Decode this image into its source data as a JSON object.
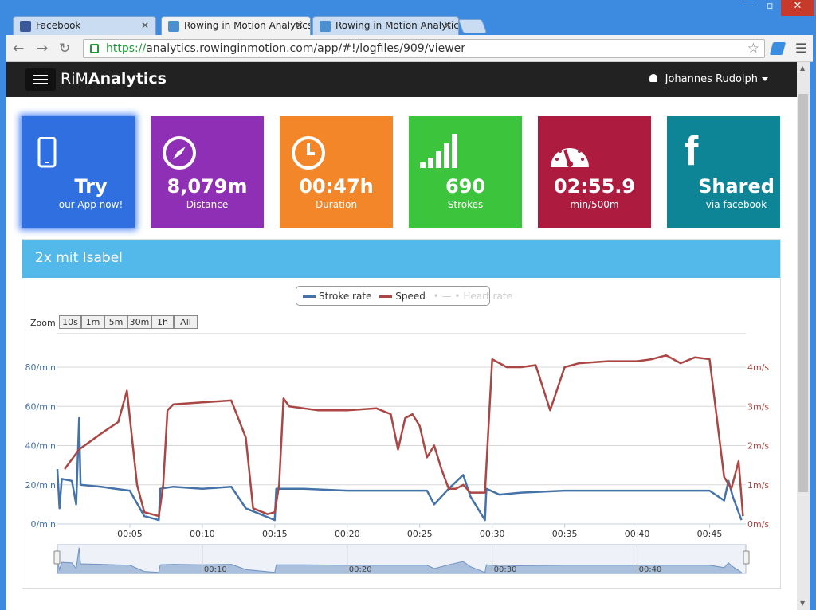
{
  "browser": {
    "tabs": [
      {
        "title": "Facebook",
        "favicon_color": "#3b5998"
      },
      {
        "title": "Rowing in Motion Analytics",
        "favicon_color": "#4a90d0"
      },
      {
        "title": "Rowing in Motion Analytics",
        "favicon_color": "#4a90d0"
      }
    ],
    "url_scheme": "https://",
    "url_rest": "analytics.rowinginmotion.com/app/#!/logfiles/909/viewer"
  },
  "navbar": {
    "brand_light": "RiM",
    "brand_bold": "Analytics",
    "user_name": "Johannes Rudolph"
  },
  "tiles": [
    {
      "value": "Try",
      "label": "our App now!",
      "color": "#2f6fe0",
      "icon": "phone-icon"
    },
    {
      "value": "8,079m",
      "label": "Distance",
      "color": "#8e2fb5",
      "icon": "compass-icon"
    },
    {
      "value": "00:47h",
      "label": "Duration",
      "color": "#f4862a",
      "icon": "clock-icon"
    },
    {
      "value": "690",
      "label": "Strokes",
      "color": "#3dc43d",
      "icon": "signal-bars-icon"
    },
    {
      "value": "02:55.9",
      "label": "min/500m",
      "color": "#ad1c3e",
      "icon": "speedometer-icon"
    },
    {
      "value": "Shared",
      "label": "via facebook",
      "color": "#0d8597",
      "icon": "facebook-icon"
    }
  ],
  "panel": {
    "title": "2x mit Isabel"
  },
  "legend": {
    "stroke_rate": "Stroke rate",
    "speed": "Speed",
    "heart_rate": "Heart rate"
  },
  "zoom": {
    "label": "Zoom",
    "buttons": [
      "10s",
      "1m",
      "5m",
      "30m",
      "1h",
      "All"
    ]
  },
  "chart_data": {
    "type": "line",
    "x_unit": "mm:ss",
    "x_ticks": [
      "00:05",
      "00:10",
      "00:15",
      "00:20",
      "00:25",
      "00:30",
      "00:35",
      "00:40",
      "00:45"
    ],
    "y_left_ticks": [
      "0/min",
      "20/min",
      "40/min",
      "60/min",
      "80/min"
    ],
    "y_right_ticks": [
      "0m/s",
      "1m/s",
      "2m/s",
      "3m/s",
      "4m/s"
    ],
    "y_left_range": [
      0,
      80
    ],
    "y_right_range": [
      0,
      4
    ],
    "navigator_ticks": [
      "00:10",
      "00:20",
      "00:30",
      "00:40"
    ],
    "series": [
      {
        "name": "Stroke rate",
        "color": "#4572a7",
        "axis": "left",
        "points": [
          [
            0.0,
            28
          ],
          [
            0.15,
            8
          ],
          [
            0.3,
            23
          ],
          [
            1.0,
            22
          ],
          [
            1.3,
            10
          ],
          [
            1.5,
            54
          ],
          [
            1.6,
            20
          ],
          [
            3,
            19
          ],
          [
            4,
            18
          ],
          [
            5,
            17
          ],
          [
            6,
            4
          ],
          [
            7,
            2
          ],
          [
            7.1,
            18
          ],
          [
            8,
            19
          ],
          [
            10,
            18
          ],
          [
            12,
            19
          ],
          [
            13,
            8
          ],
          [
            15,
            2
          ],
          [
            15.1,
            18
          ],
          [
            17,
            18
          ],
          [
            20,
            17
          ],
          [
            23,
            17
          ],
          [
            25.5,
            17
          ],
          [
            26,
            10
          ],
          [
            27,
            18
          ],
          [
            28,
            25
          ],
          [
            28.5,
            14
          ],
          [
            29.5,
            2
          ],
          [
            29.6,
            18
          ],
          [
            30.5,
            15
          ],
          [
            32,
            16
          ],
          [
            35,
            17
          ],
          [
            38,
            17
          ],
          [
            40,
            17
          ],
          [
            43,
            17
          ],
          [
            45,
            17
          ],
          [
            46,
            12
          ],
          [
            46.3,
            22
          ],
          [
            46.6,
            14
          ],
          [
            47.2,
            2
          ]
        ]
      },
      {
        "name": "Speed",
        "color": "#aa4643",
        "axis": "right",
        "points": [
          [
            0.5,
            1.4
          ],
          [
            1.5,
            1.9
          ],
          [
            3,
            2.3
          ],
          [
            4.2,
            2.6
          ],
          [
            4.8,
            3.4
          ],
          [
            5.5,
            1.0
          ],
          [
            6,
            0.3
          ],
          [
            7,
            0.2
          ],
          [
            7.3,
            1.0
          ],
          [
            7.6,
            2.9
          ],
          [
            8,
            3.05
          ],
          [
            10,
            3.1
          ],
          [
            12,
            3.15
          ],
          [
            13,
            2.2
          ],
          [
            13.5,
            0.4
          ],
          [
            14.5,
            0.25
          ],
          [
            15,
            0.3
          ],
          [
            15.3,
            1.0
          ],
          [
            15.6,
            3.2
          ],
          [
            16,
            3.0
          ],
          [
            18,
            2.9
          ],
          [
            20,
            2.9
          ],
          [
            22,
            2.95
          ],
          [
            23,
            2.8
          ],
          [
            23.5,
            1.9
          ],
          [
            24,
            2.7
          ],
          [
            24.5,
            2.8
          ],
          [
            25,
            2.5
          ],
          [
            25.5,
            1.7
          ],
          [
            26,
            2.0
          ],
          [
            26.5,
            1.4
          ],
          [
            27,
            0.9
          ],
          [
            27.5,
            0.9
          ],
          [
            28,
            1.0
          ],
          [
            28.5,
            0.8
          ],
          [
            29.5,
            0.8
          ],
          [
            30,
            4.2
          ],
          [
            31,
            4.0
          ],
          [
            32,
            4.0
          ],
          [
            33,
            4.05
          ],
          [
            34,
            2.9
          ],
          [
            35,
            4.0
          ],
          [
            36,
            4.1
          ],
          [
            38,
            4.15
          ],
          [
            40,
            4.15
          ],
          [
            41,
            4.2
          ],
          [
            42,
            4.3
          ],
          [
            43,
            4.1
          ],
          [
            44,
            4.25
          ],
          [
            45,
            4.2
          ],
          [
            46,
            1.2
          ],
          [
            46.5,
            0.9
          ],
          [
            47,
            1.6
          ],
          [
            47.3,
            0.2
          ]
        ]
      }
    ]
  }
}
